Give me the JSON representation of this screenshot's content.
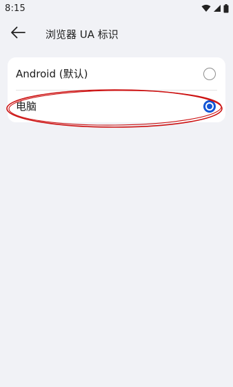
{
  "status_bar": {
    "time": "8:15",
    "icons": [
      "wifi-icon",
      "signal-icon",
      "battery-icon"
    ]
  },
  "app_bar": {
    "back_icon": "arrow-left-icon",
    "title": "浏览器 UA 标识"
  },
  "options": [
    {
      "label": "Android (默认)",
      "selected": false
    },
    {
      "label": "电脑",
      "selected": true
    }
  ],
  "colors": {
    "background": "#f1f2f6",
    "card": "#ffffff",
    "accent": "#1356d6",
    "annotation": "#cc1111"
  }
}
